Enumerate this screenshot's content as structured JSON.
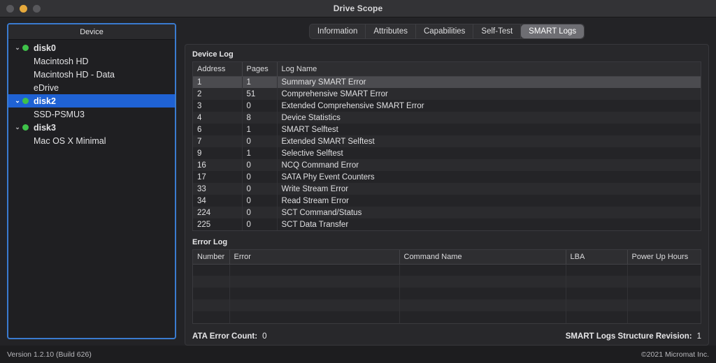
{
  "window": {
    "title": "Drive Scope",
    "controls": [
      {
        "name": "close",
        "color": "#58585c"
      },
      {
        "name": "minimize",
        "color": "#e6a93c"
      },
      {
        "name": "zoom",
        "color": "#58585c"
      }
    ]
  },
  "sidebar": {
    "header": "Device",
    "items": [
      {
        "label": "disk0",
        "type": "disk",
        "expanded": true,
        "status": "green",
        "selected": false
      },
      {
        "label": "Macintosh HD",
        "type": "volume",
        "expanded": false,
        "status": "",
        "selected": false
      },
      {
        "label": "Macintosh HD - Data",
        "type": "volume",
        "expanded": false,
        "status": "",
        "selected": false
      },
      {
        "label": "eDrive",
        "type": "volume",
        "expanded": false,
        "status": "",
        "selected": false
      },
      {
        "label": "disk2",
        "type": "disk",
        "expanded": true,
        "status": "green",
        "selected": true
      },
      {
        "label": "SSD-PSMU3",
        "type": "volume",
        "expanded": false,
        "status": "",
        "selected": false
      },
      {
        "label": "disk3",
        "type": "disk",
        "expanded": true,
        "status": "green",
        "selected": false
      },
      {
        "label": "Mac OS X Minimal",
        "type": "volume",
        "expanded": false,
        "status": "",
        "selected": false
      }
    ]
  },
  "tabs": {
    "items": [
      {
        "label": "Information",
        "active": false
      },
      {
        "label": "Attributes",
        "active": false
      },
      {
        "label": "Capabilities",
        "active": false
      },
      {
        "label": "Self-Test",
        "active": false
      },
      {
        "label": "SMART Logs",
        "active": true
      }
    ]
  },
  "device_log": {
    "title": "Device Log",
    "columns": [
      "Address",
      "Pages",
      "Log Name"
    ],
    "rows": [
      {
        "address": "1",
        "pages": "1",
        "log_name": "Summary SMART Error",
        "selected": true
      },
      {
        "address": "2",
        "pages": "51",
        "log_name": "Comprehensive SMART Error",
        "selected": false
      },
      {
        "address": "3",
        "pages": "0",
        "log_name": "Extended Comprehensive SMART Error",
        "selected": false
      },
      {
        "address": "4",
        "pages": "8",
        "log_name": "Device Statistics",
        "selected": false
      },
      {
        "address": "6",
        "pages": "1",
        "log_name": "SMART Selftest",
        "selected": false
      },
      {
        "address": "7",
        "pages": "0",
        "log_name": "Extended SMART Selftest",
        "selected": false
      },
      {
        "address": "9",
        "pages": "1",
        "log_name": "Selective Selftest",
        "selected": false
      },
      {
        "address": "16",
        "pages": "0",
        "log_name": "NCQ Command Error",
        "selected": false
      },
      {
        "address": "17",
        "pages": "0",
        "log_name": "SATA Phy Event Counters",
        "selected": false
      },
      {
        "address": "33",
        "pages": "0",
        "log_name": "Write Stream Error",
        "selected": false
      },
      {
        "address": "34",
        "pages": "0",
        "log_name": "Read Stream Error",
        "selected": false
      },
      {
        "address": "224",
        "pages": "0",
        "log_name": "SCT Command/Status",
        "selected": false
      },
      {
        "address": "225",
        "pages": "0",
        "log_name": "SCT Data Transfer",
        "selected": false
      }
    ]
  },
  "error_log": {
    "title": "Error Log",
    "columns": [
      "Number",
      "Error",
      "Command Name",
      "LBA",
      "Power Up Hours"
    ],
    "rows": [
      {
        "number": "",
        "error": "",
        "command_name": "",
        "lba": "",
        "power_up_hours": ""
      },
      {
        "number": "",
        "error": "",
        "command_name": "",
        "lba": "",
        "power_up_hours": ""
      },
      {
        "number": "",
        "error": "",
        "command_name": "",
        "lba": "",
        "power_up_hours": ""
      },
      {
        "number": "",
        "error": "",
        "command_name": "",
        "lba": "",
        "power_up_hours": ""
      },
      {
        "number": "",
        "error": "",
        "command_name": "",
        "lba": "",
        "power_up_hours": ""
      }
    ]
  },
  "stats": {
    "ata_error_count_label": "ATA Error Count:",
    "ata_error_count_value": "0",
    "structure_revision_label": "SMART Logs Structure Revision:",
    "structure_revision_value": "1"
  },
  "footer": {
    "version": "Version 1.2.10 (Build 626)",
    "copyright": "©2021 Micromat Inc."
  },
  "colors": {
    "accent_selection": "#1f62d4",
    "focus_ring": "#3a7bd0",
    "status_green": "#3fc24a",
    "window_amber": "#e6a93c"
  }
}
